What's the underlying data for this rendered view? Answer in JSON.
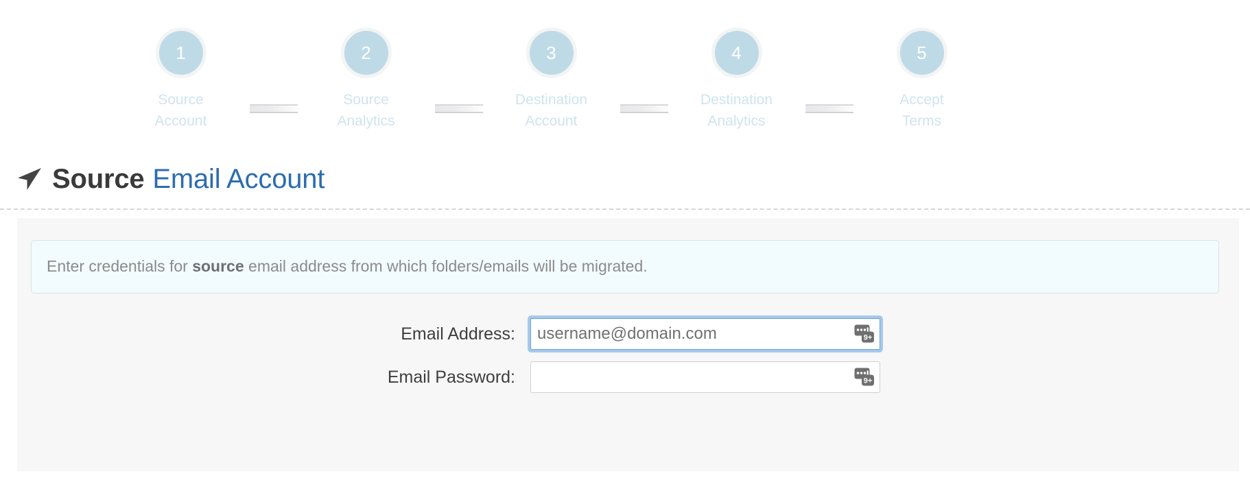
{
  "wizard": {
    "steps": [
      {
        "number": "1",
        "line1": "Source",
        "line2": "Account"
      },
      {
        "number": "2",
        "line1": "Source",
        "line2": "Analytics"
      },
      {
        "number": "3",
        "line1": "Destination",
        "line2": "Account"
      },
      {
        "number": "4",
        "line1": "Destination",
        "line2": "Analytics"
      },
      {
        "number": "5",
        "line1": "Accept",
        "line2": "Terms"
      }
    ],
    "bubble_color": "#bfdae7",
    "label_color": "#cfe4ee"
  },
  "heading": {
    "icon": "location-arrow-icon",
    "strong": "Source",
    "light": "Email Account",
    "strong_color": "#3a3a3a",
    "light_color": "#2c6cb0"
  },
  "panel": {
    "alert": {
      "before": "Enter credentials for ",
      "bold": "source",
      "after": " email address from which folders/emails will be migrated.",
      "background": "#f2fbfd",
      "border": "#d8e3e3"
    },
    "fields": [
      {
        "label": "Email Address:",
        "value": "",
        "placeholder": "username@domain.com",
        "type": "text",
        "focused": true,
        "icon": "password-manager-icon",
        "icon_badge": "9+"
      },
      {
        "label": "Email Password:",
        "value": "",
        "placeholder": "",
        "type": "password",
        "focused": false,
        "icon": "password-manager-icon",
        "icon_badge": "9+"
      }
    ]
  }
}
